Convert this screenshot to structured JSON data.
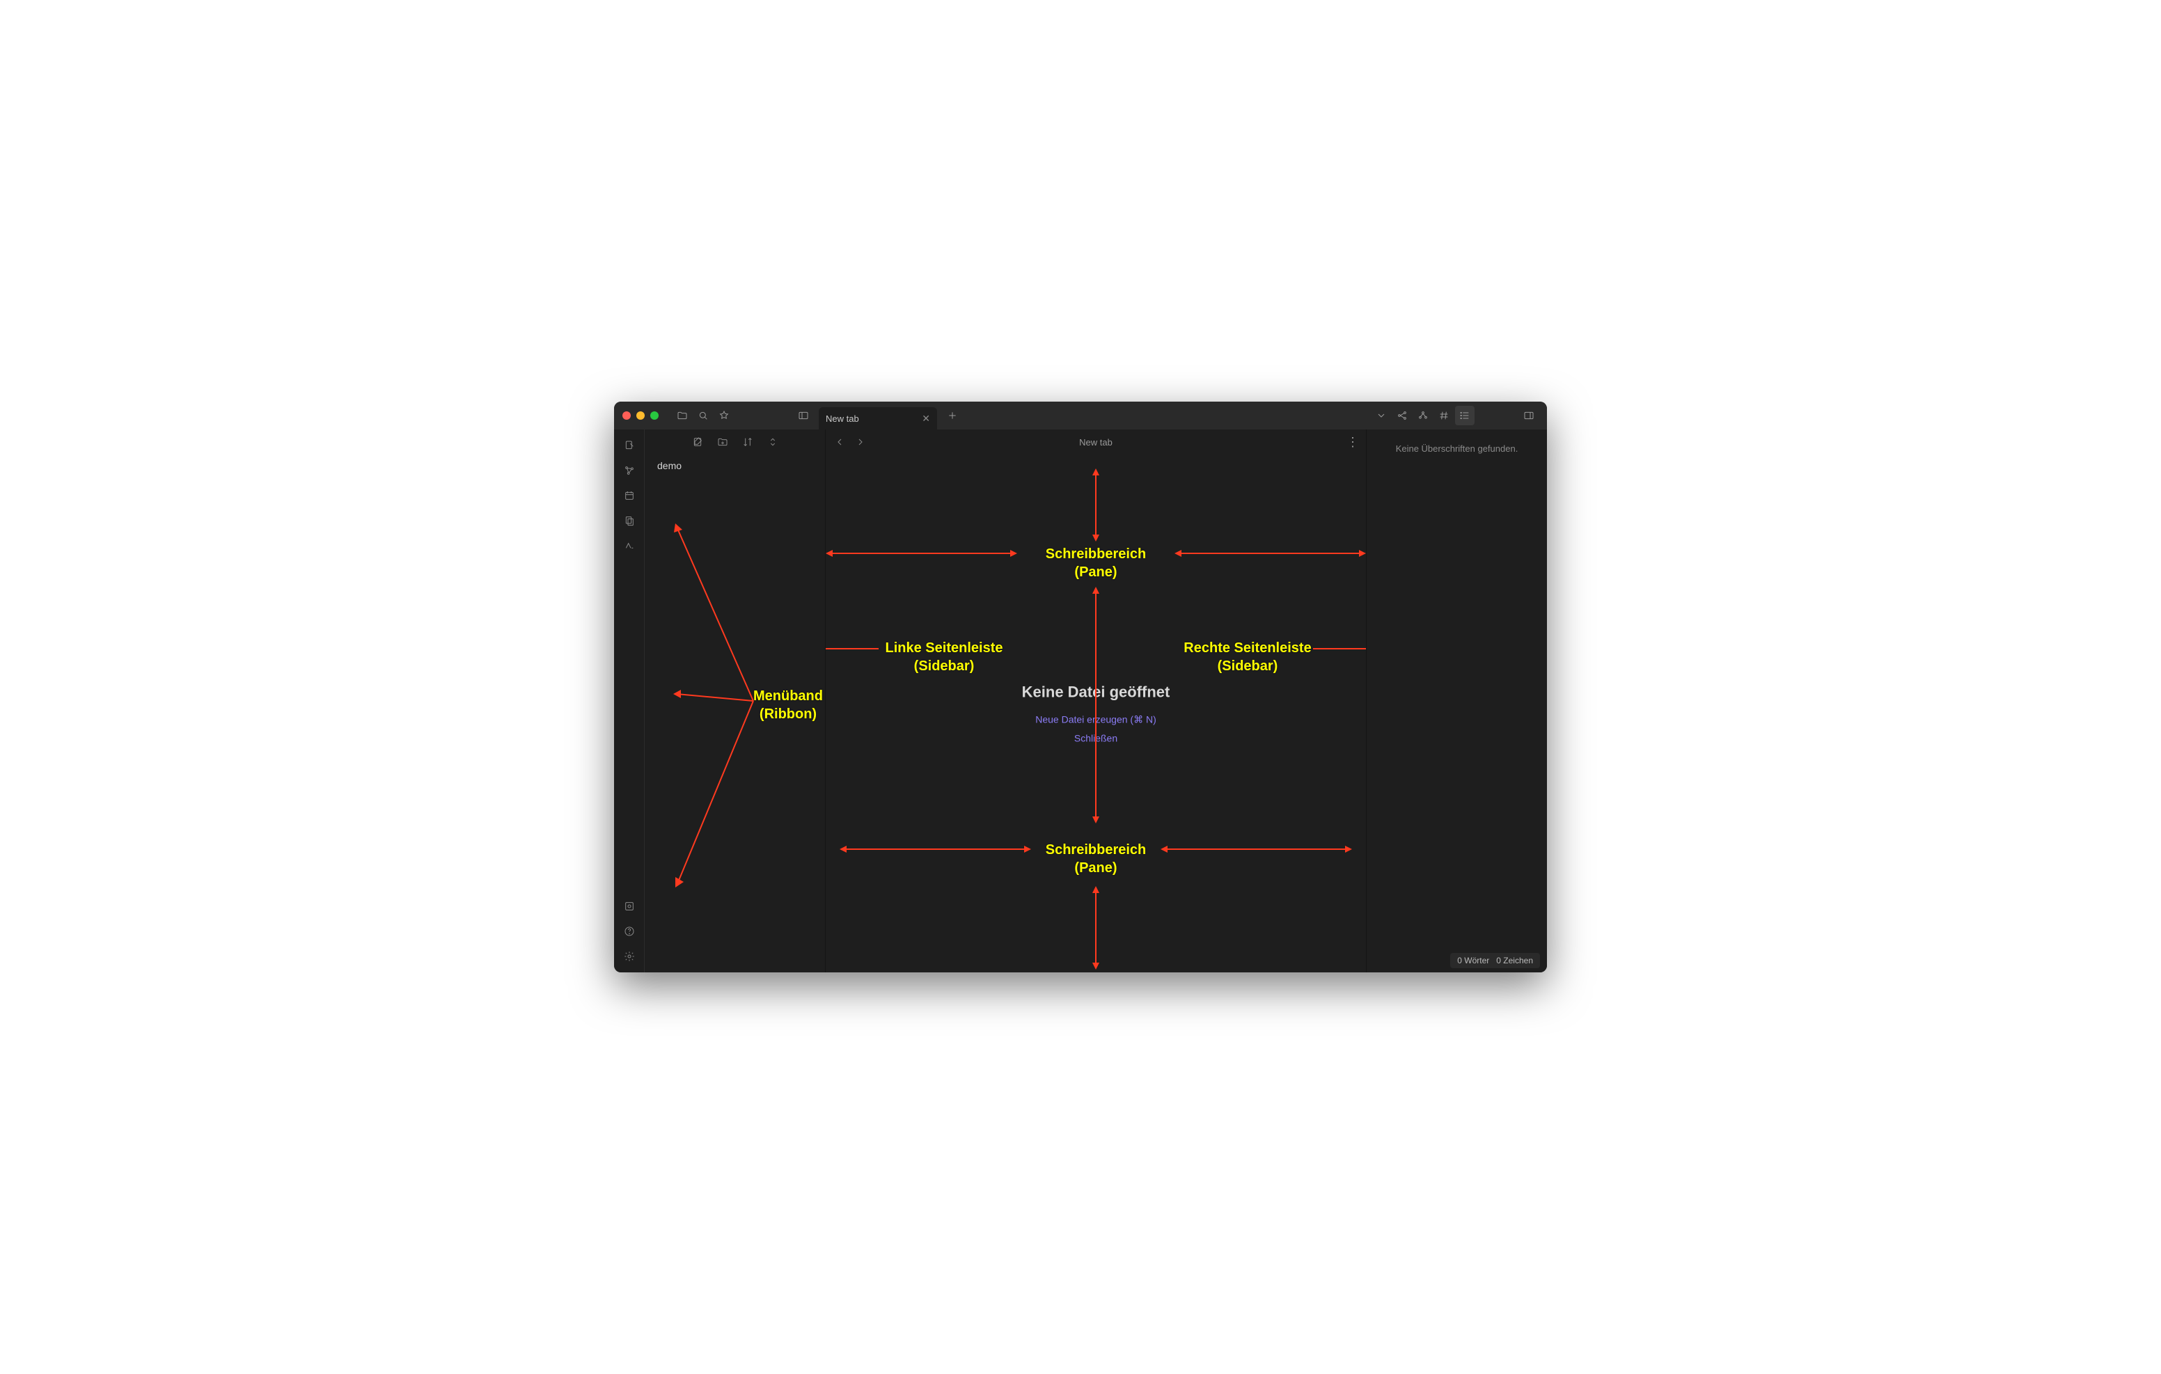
{
  "titlebar": {
    "tab_label": "New tab"
  },
  "sidebar": {
    "vault_name": "demo"
  },
  "note_header": {
    "title": "New tab"
  },
  "empty_state": {
    "heading": "Keine Datei geöffnet",
    "new_file": "Neue Datei erzeugen (⌘ N)",
    "close": "Schließen"
  },
  "right_sidebar": {
    "no_headings": "Keine Überschriften gefunden."
  },
  "statusbar": {
    "words": "0 Wörter",
    "chars": "0 Zeichen"
  },
  "annotations": {
    "ribbon": "Menüband\n(Ribbon)",
    "left_sidebar": "Linke Seitenleiste\n(Sidebar)",
    "right_sidebar": "Rechte Seitenleiste\n(Sidebar)",
    "pane_top": "Schreibbereich\n(Pane)",
    "pane_bottom": "Schreibbereich\n(Pane)"
  }
}
